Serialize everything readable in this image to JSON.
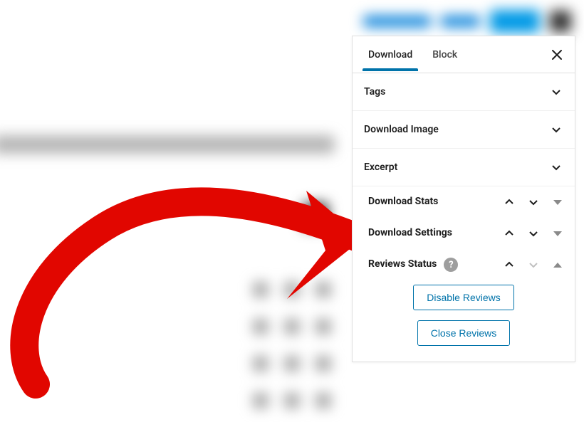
{
  "tabs": {
    "download": "Download",
    "block": "Block"
  },
  "accordion": {
    "tags": "Tags",
    "download_image": "Download Image",
    "excerpt": "Excerpt"
  },
  "meta": {
    "download_stats": "Download Stats",
    "download_settings": "Download Settings",
    "reviews_status": "Reviews Status"
  },
  "reviews": {
    "help_glyph": "?",
    "disable": "Disable Reviews",
    "close": "Close Reviews"
  }
}
